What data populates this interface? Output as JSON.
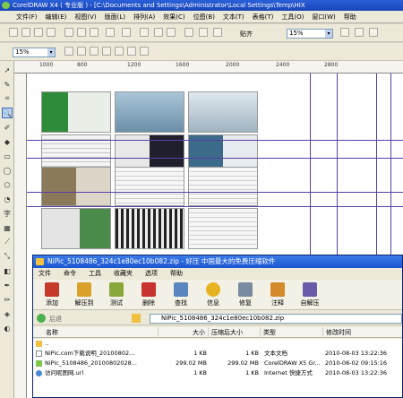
{
  "corel": {
    "title": "CorelDRAW X4 ( 专业版 ) - [C:\\Documents and Settings\\Administrator\\Local Settings\\Temp\\HIX",
    "menu": [
      "文件(F)",
      "编辑(E)",
      "视图(V)",
      "版面(L)",
      "排列(A)",
      "效果(C)",
      "位图(B)",
      "文本(T)",
      "表格(T)",
      "工具(O)",
      "窗口(W)",
      "帮助"
    ],
    "zoom_value": "15%",
    "zoom_value_2": "15%",
    "snap_label": "贴齐",
    "ruler_labels": [
      "1000",
      "800",
      "1200",
      "1600",
      "2000",
      "2400",
      "2800"
    ]
  },
  "rar": {
    "title": "NiPic_5108486_324c1e80ec10b082.zip - 好压 中国最大的免费压缩软件",
    "menu": [
      "文件",
      "命令",
      "工具",
      "收藏夹",
      "选项",
      "帮助"
    ],
    "tools": [
      {
        "label": "添加",
        "color": "#c63a2a"
      },
      {
        "label": "解压到",
        "color": "#d9a02a"
      },
      {
        "label": "测试",
        "color": "#8aa83a"
      },
      {
        "label": "删除",
        "color": "#c8322f"
      },
      {
        "label": "查找",
        "color": "#5a86c0"
      },
      {
        "label": "信息",
        "color": "#e6b422"
      },
      {
        "label": "修复",
        "color": "#7a8aa0"
      },
      {
        "label": "注释",
        "color": "#d48a2a"
      },
      {
        "label": "自解压",
        "color": "#6a5aa8"
      }
    ],
    "back_label": "后退",
    "path": "NiPic_5108486_324c1e80ec10b082.zip",
    "columns": [
      "名称",
      "大小",
      "压缩后大小",
      "类型",
      "修改时间"
    ],
    "rows": [
      {
        "name": "..",
        "size": "",
        "packed": "",
        "type": "",
        "modified": ""
      },
      {
        "name": "NiPic.com下载说明_20100802...",
        "size": "1 KB",
        "packed": "1 KB",
        "type": "文本文档",
        "modified": "2010-08-03 13:22:36"
      },
      {
        "name": "NiPic_5108486_20100802028...",
        "size": "299.02 MB",
        "packed": "299.02 MB",
        "type": "CorelDRAW X5 Gr...",
        "modified": "2010-08-02 09:15:16"
      },
      {
        "name": "访问昵图网.url",
        "size": "1 KB",
        "packed": "1 KB",
        "type": "Internet 快捷方式",
        "modified": "2010-08-03 13:22:36"
      }
    ]
  }
}
